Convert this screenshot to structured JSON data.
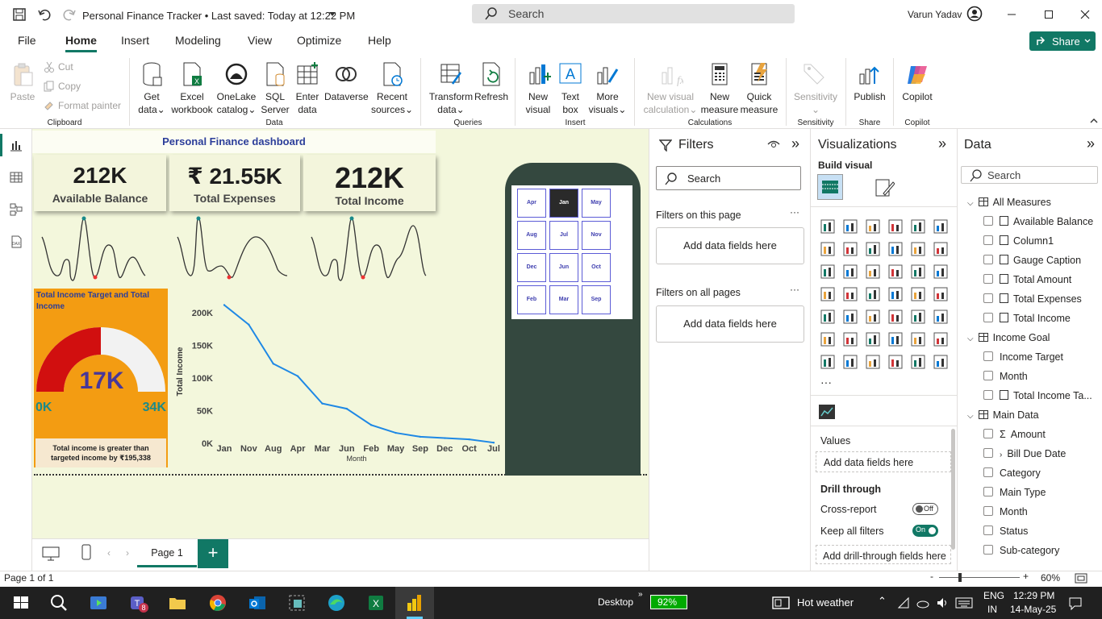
{
  "window": {
    "title": "Personal Finance Tracker",
    "saved": "• Last saved: Today at 12:22 PM",
    "search_placeholder": "Search",
    "user": "Varun Yadav"
  },
  "ribbon_tabs": [
    "File",
    "Home",
    "Insert",
    "Modeling",
    "View",
    "Optimize",
    "Help"
  ],
  "share_label": "Share",
  "clipboard": {
    "paste": "Paste",
    "cut": "Cut",
    "copy": "Copy",
    "format_painter": "Format painter",
    "group": "Clipboard"
  },
  "data_group": {
    "get_data": [
      "Get",
      "data"
    ],
    "excel": [
      "Excel",
      "workbook"
    ],
    "onelake": [
      "OneLake",
      "catalog"
    ],
    "sql": [
      "SQL",
      "Server"
    ],
    "enter": [
      "Enter",
      "data"
    ],
    "dataverse": "Dataverse",
    "recent": [
      "Recent",
      "sources"
    ],
    "group": "Data"
  },
  "queries": {
    "transform": [
      "Transform",
      "data"
    ],
    "refresh": "Refresh",
    "group": "Queries"
  },
  "insert": {
    "new_visual": [
      "New",
      "visual"
    ],
    "text_box": [
      "Text",
      "box"
    ],
    "more": [
      "More",
      "visuals"
    ],
    "group": "Insert"
  },
  "calculations": {
    "new_calc": [
      "New visual",
      "calculation"
    ],
    "new_measure": [
      "New",
      "measure"
    ],
    "quick_measure": [
      "Quick",
      "measure"
    ],
    "group": "Calculations"
  },
  "sensitivity": {
    "label": "Sensitivity",
    "group": "Sensitivity"
  },
  "share_group": {
    "publish": "Publish",
    "group": "Share"
  },
  "copilot": {
    "label": "Copilot",
    "group": "Copilot"
  },
  "dashboard": {
    "title": "Personal Finance dashboard",
    "kpis": [
      {
        "value": "212K",
        "label": "Available Balance"
      },
      {
        "value": "₹ 21.55K",
        "label": "Total Expenses"
      },
      {
        "value": "212K",
        "label": "Total Income"
      }
    ],
    "gauge": {
      "title": "Total Income Target and Total Income",
      "value": "17K",
      "min": "0K",
      "max": "34K",
      "fraction": 0.5,
      "note": "Total income is greater than targeted income by ₹195,338"
    },
    "months_slicer": [
      "Apr",
      "Jan",
      "May",
      "Aug",
      "Jul",
      "Nov",
      "Dec",
      "Jun",
      "Oct",
      "Feb",
      "Mar",
      "Sep"
    ],
    "selected_month": "Jan"
  },
  "chart_data": {
    "type": "line",
    "categories": [
      "Jan",
      "Nov",
      "Aug",
      "Apr",
      "Mar",
      "Jun",
      "Feb",
      "May",
      "Sep",
      "Dec",
      "Oct",
      "Jul"
    ],
    "values": [
      212000,
      182000,
      122000,
      103000,
      61000,
      53000,
      28000,
      16000,
      10000,
      8000,
      6000,
      1000
    ],
    "xlabel": "Month",
    "ylabel": "Total Income",
    "yticks": [
      "0K",
      "50K",
      "100K",
      "150K",
      "200K"
    ],
    "ylim": [
      0,
      220000
    ],
    "color": "#1e88e5"
  },
  "page_tab": "Page 1",
  "filters": {
    "title": "Filters",
    "search": "Search",
    "on_page": "Filters on this page",
    "on_all": "Filters on all pages",
    "add": "Add data fields here"
  },
  "viz": {
    "title": "Visualizations",
    "build": "Build visual",
    "values": "Values",
    "add_values": "Add data fields here",
    "drill": "Drill through",
    "cross": "Cross-report",
    "cross_state": "Off",
    "keep": "Keep all filters",
    "keep_state": "On",
    "add_drill": "Add drill-through fields here"
  },
  "data_pane": {
    "title": "Data",
    "search": "Search",
    "tables": [
      {
        "name": "All Measures",
        "fields": [
          "Available Balance",
          "Column1",
          "Gauge Caption",
          "Total Amount",
          "Total Expenses",
          "Total Income"
        ]
      },
      {
        "name": "Income Goal",
        "fields": [
          "Income Target",
          "Month",
          "Total Income Ta..."
        ]
      },
      {
        "name": "Main Data",
        "fields": [
          "Amount",
          "Bill Due Date",
          "Category",
          "Main Type",
          "Month",
          "Status",
          "Sub-category"
        ]
      }
    ]
  },
  "status": {
    "page": "Page 1 of 1",
    "zoom": "60%"
  },
  "taskbar": {
    "desktop": "Desktop",
    "battery": "92%",
    "weather": "Hot weather",
    "lang": "ENG",
    "region": "IN",
    "time": "12:29 PM",
    "date": "14-May-25",
    "teams_badge": "8"
  }
}
